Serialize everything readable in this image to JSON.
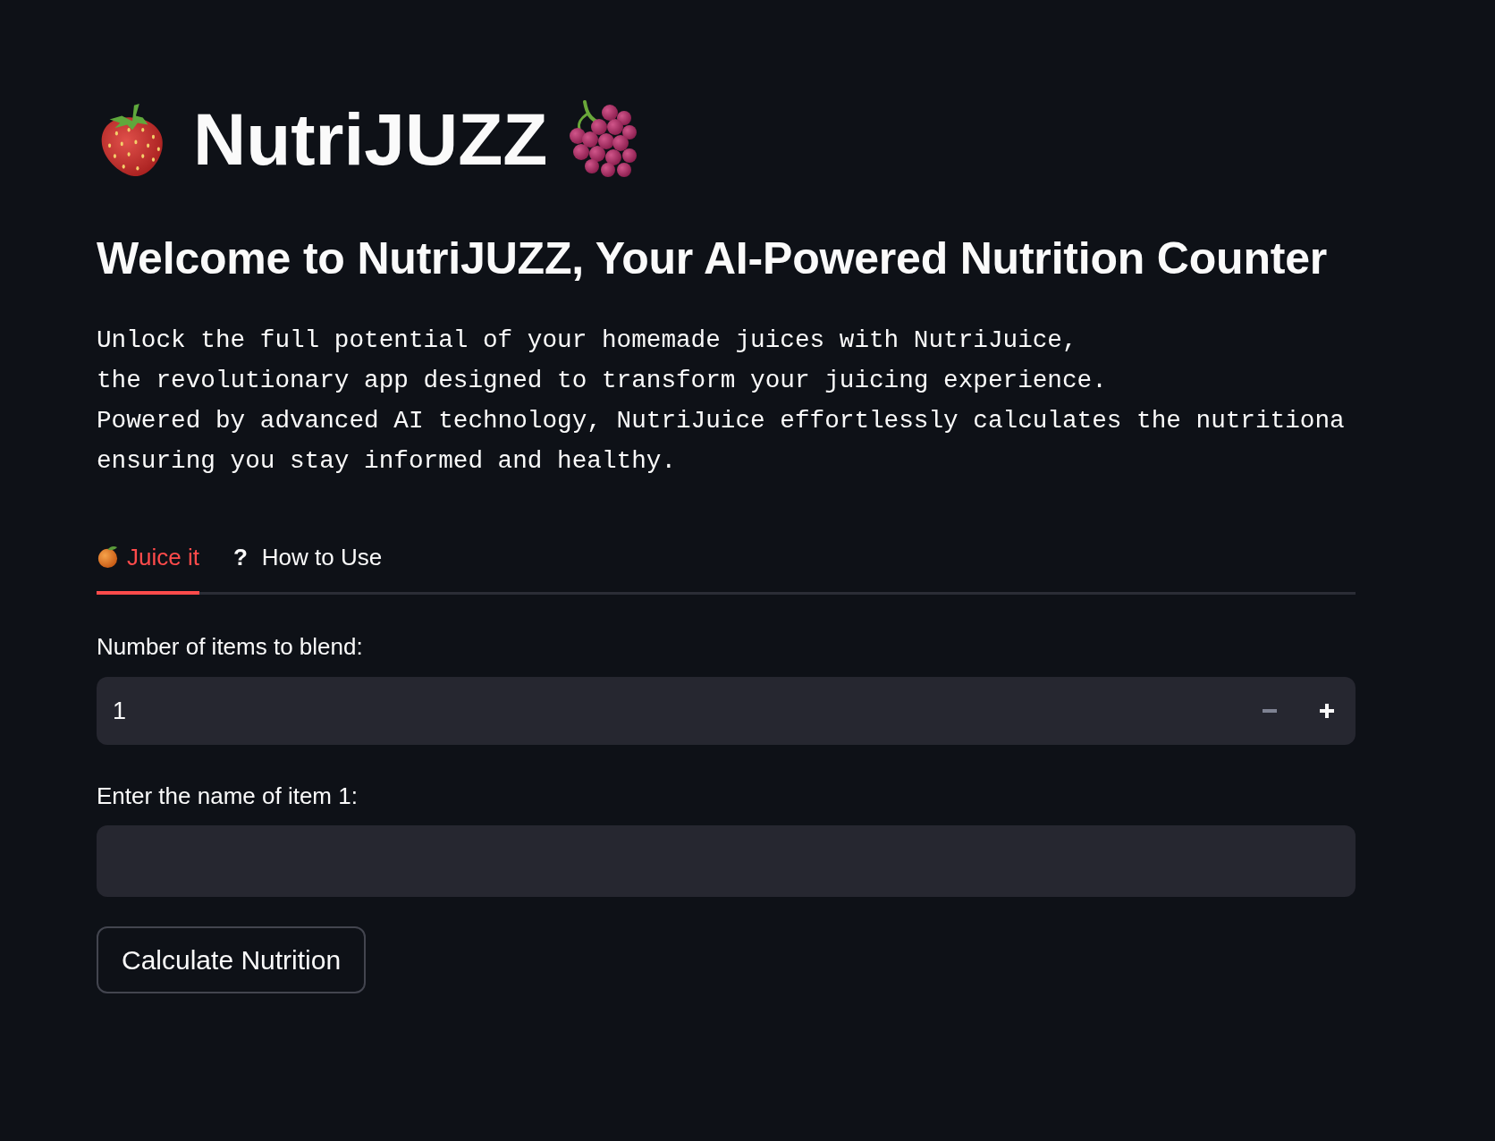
{
  "title": "NutriJUZZ",
  "heading": "Welcome to NutriJUZZ, Your AI-Powered Nutrition Counter",
  "intro_lines": [
    "Unlock the full potential of your homemade juices with NutriJuice,",
    "the revolutionary app designed to transform your juicing experience.",
    "Powered by advanced AI technology, NutriJuice effortlessly calculates the nutritiona",
    "ensuring you stay informed and healthy."
  ],
  "tabs": [
    {
      "kind": "icon",
      "label": "Juice it",
      "selected": true
    },
    {
      "kind": "glyph",
      "glyph": "?",
      "label": "How to Use",
      "selected": false
    }
  ],
  "number_input": {
    "label": "Number of items to blend:",
    "value": "1",
    "decrement_disabled": true
  },
  "text_input": {
    "label": "Enter the name of item 1:"
  },
  "button": {
    "label": "Calculate Nutrition"
  }
}
